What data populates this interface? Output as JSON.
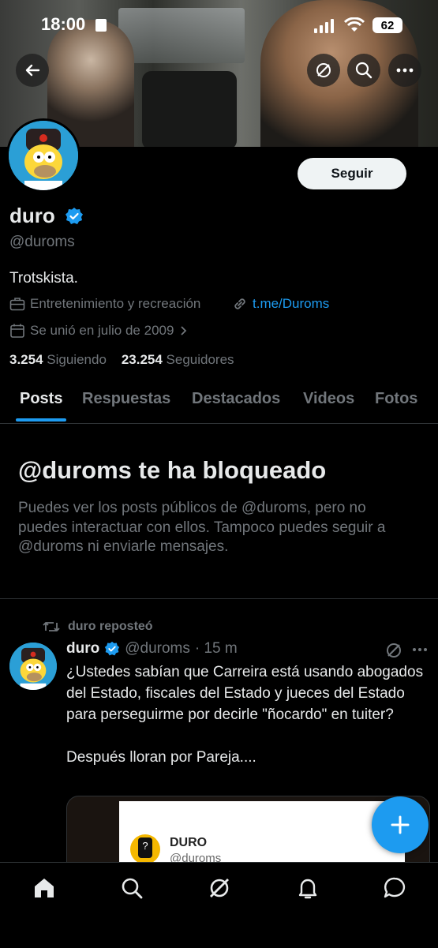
{
  "status": {
    "time": "18:00",
    "battery": "62"
  },
  "header": {
    "back_label": "back",
    "grok_label": "grok",
    "search_label": "search",
    "more_label": "more"
  },
  "profile": {
    "follow_label": "Seguir",
    "name": "duro",
    "handle": "@duroms",
    "bio": "Trotskista.",
    "category": "Entretenimiento y recreación",
    "link": "t.me/Duroms",
    "joined": "Se unió en julio de 2009",
    "following_count": "3.254",
    "following_label": "Siguiendo",
    "followers_count": "23.254",
    "followers_label": "Seguidores"
  },
  "tabs": [
    "Posts",
    "Respuestas",
    "Destacados",
    "Videos",
    "Fotos"
  ],
  "blocked": {
    "title": "@duroms te ha bloqueado",
    "description": "Puedes ver los posts públicos de @duroms, pero no puedes interactuar con ellos. Tampoco puedes seguir a @duroms ni enviarle mensajes."
  },
  "post": {
    "repost_label": "duro reposteó",
    "author": "duro",
    "handle": "@duroms",
    "time": "· 15 m",
    "text_1": "¿Ustedes sabían que Carreira está usando abogados del Estado, fiscales del Estado y jueces del Estado para perseguirme por decirle \"ñocardo\" en tuiter?",
    "text_2": "Después lloran por Pareja....",
    "card_name": "DURO",
    "card_handle": "@duroms"
  },
  "colors": {
    "accent": "#1d9bf0",
    "muted": "#71767b",
    "text": "#e7e9ea",
    "background": "#000000"
  }
}
